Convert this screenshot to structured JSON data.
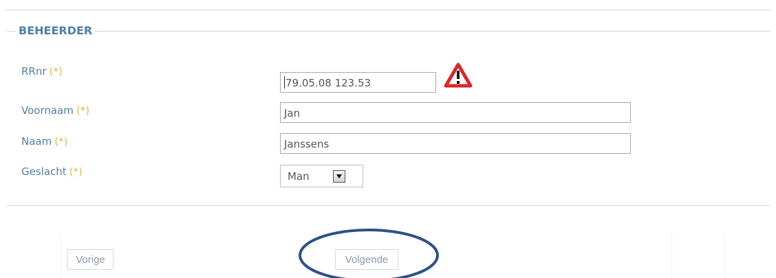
{
  "form": {
    "legend": "BEHEERDER",
    "required_marker": "(*)",
    "fields": {
      "rrnr": {
        "label": "RRnr",
        "value": "79.05.08 123.53"
      },
      "voornaam": {
        "label": "Voornaam",
        "value": "Jan"
      },
      "naam": {
        "label": "Naam",
        "value": "Janssens"
      },
      "geslacht": {
        "label": "Geslacht",
        "value": "Man"
      }
    }
  },
  "navigation": {
    "previous_label": "Vorige",
    "next_label": "Volgende"
  },
  "icons": {
    "warning": "warning-icon",
    "dropdown": "chevron-down-icon"
  },
  "colors": {
    "label": "#557e9f",
    "required": "#e0b84d",
    "legend": "#4f7fa8",
    "warning_red": "#d72828",
    "highlight": "#2f4f86"
  }
}
